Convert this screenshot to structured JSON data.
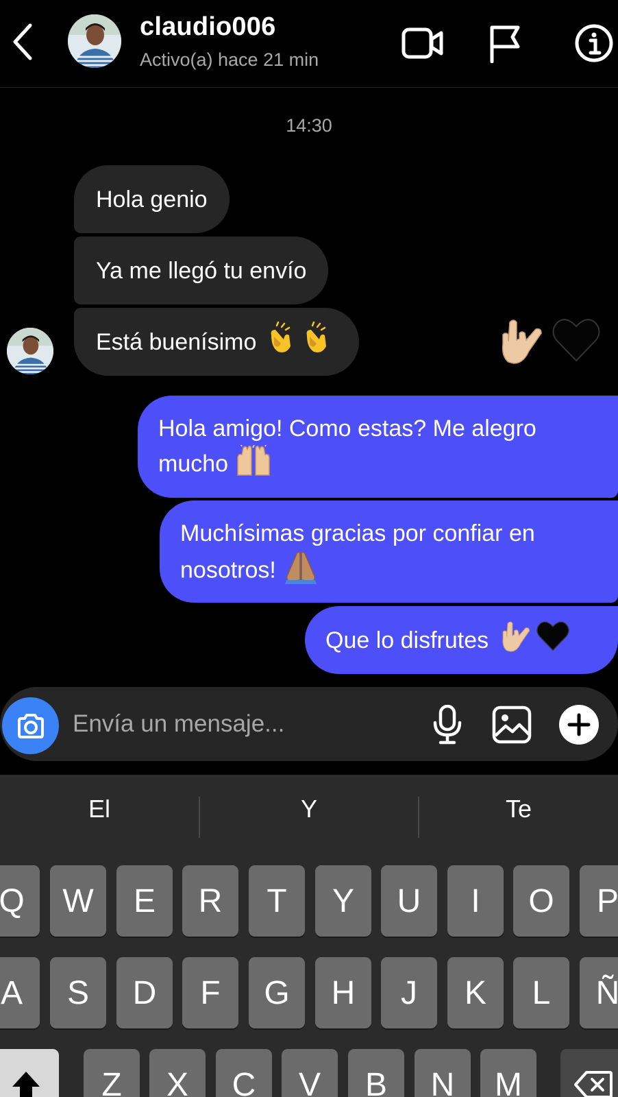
{
  "header": {
    "username": "claudio006",
    "status": "Activo(a) hace 21 min"
  },
  "chat": {
    "timestamp": "14:30",
    "incoming": [
      {
        "text": "Hola genio"
      },
      {
        "text": "Ya me llegó tu envío"
      },
      {
        "text": "Está buenísimo",
        "emoji": [
          "clapping-hands",
          "clapping-hands"
        ]
      }
    ],
    "reactions": [
      "love-you-gesture",
      "black-heart"
    ],
    "outgoing": [
      {
        "line1": "Hola amigo! Como estas? Me alegro",
        "line2": "mucho",
        "emoji": "raising-hands"
      },
      {
        "line1": "Muchísimas gracias por confiar en",
        "line2": "nosotros!",
        "emoji": "folded-hands"
      },
      {
        "text": "Que lo disfrutes",
        "emoji": [
          "love-you-gesture",
          "black-heart"
        ]
      }
    ]
  },
  "composer": {
    "placeholder": "Envía un mensaje..."
  },
  "keyboard": {
    "suggestions": [
      "El",
      "Y",
      "Te"
    ],
    "row1": [
      "Q",
      "W",
      "E",
      "R",
      "T",
      "Y",
      "U",
      "I",
      "O",
      "P"
    ],
    "row2": [
      "A",
      "S",
      "D",
      "F",
      "G",
      "H",
      "J",
      "K",
      "L",
      "Ñ"
    ],
    "row3": [
      "Z",
      "X",
      "C",
      "V",
      "B",
      "N",
      "M"
    ]
  },
  "colors": {
    "background": "#000000",
    "incoming_bubble": "#262626",
    "outgoing_bubble": "#4d50f8",
    "camera_button": "#3b82f6",
    "secondary_text": "#a8a8a8"
  }
}
